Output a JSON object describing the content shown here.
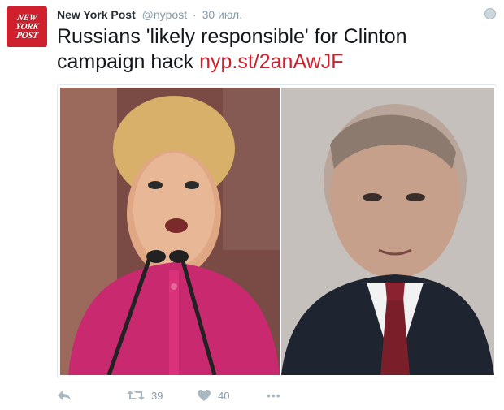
{
  "tweet": {
    "avatar_text": [
      "NEW",
      "YORK",
      "POST"
    ],
    "account_name": "New York Post",
    "handle": "@nypost",
    "separator": "·",
    "date": "30 июл.",
    "text": "Russians 'likely responsible' for Clinton campaign hack",
    "link": "nyp.st/2anAwJF",
    "media": {
      "left_icon": "photo-hillary-clinton-at-podium",
      "right_icon": "photo-vladimir-putin"
    },
    "actions": {
      "retweet_count": "39",
      "like_count": "40",
      "more_label": "•••"
    }
  },
  "colors": {
    "brand_red": "#d0202e",
    "link_red": "#d0202e",
    "muted": "#8899a6"
  }
}
